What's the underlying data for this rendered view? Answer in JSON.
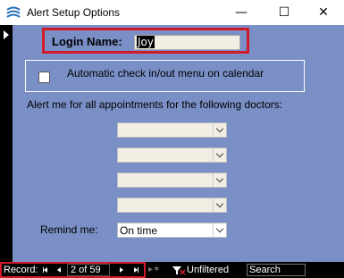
{
  "window": {
    "title": "Alert Setup Options",
    "minimize_glyph": "—",
    "maximize_glyph": "☐",
    "close_glyph": "✕"
  },
  "login": {
    "label": "Login Name:",
    "value": "Joy"
  },
  "auto_check": {
    "label": "Automatic check in/out menu on calendar",
    "checked": false
  },
  "alert": {
    "label": "Alert me for all appointments for the following doctors:",
    "doctors": [
      "",
      "",
      "",
      ""
    ]
  },
  "remind": {
    "label": "Remind me:",
    "value": "On time"
  },
  "navigation": {
    "record_label": "Record:",
    "position": "2 of 59",
    "filter_label": "Unfiltered",
    "search_placeholder": "Search",
    "new_record_glyph": "▸✶"
  },
  "colors": {
    "form_background": "#7a8fc6",
    "highlight": "#d11a2a",
    "field_background": "#f1efe4"
  }
}
